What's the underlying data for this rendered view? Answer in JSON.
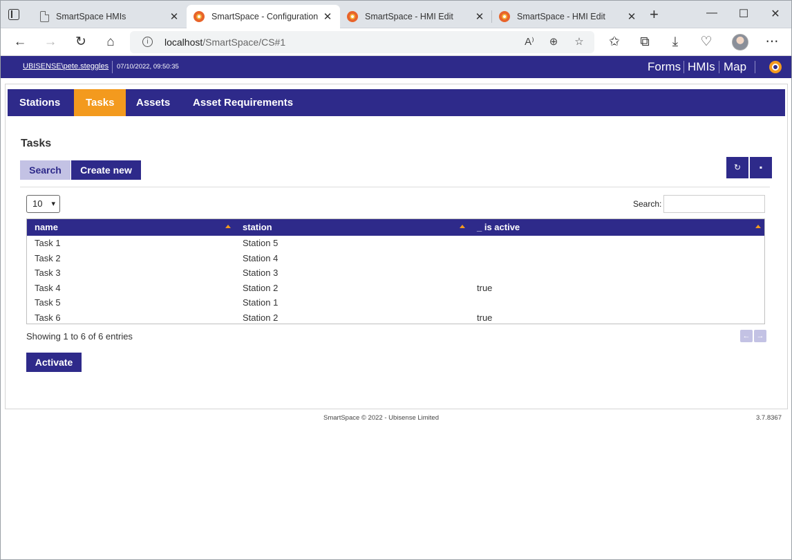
{
  "browser": {
    "tabs": [
      {
        "label": "SmartSpace HMIs",
        "active": false
      },
      {
        "label": "SmartSpace - Configuration",
        "active": true
      },
      {
        "label": "SmartSpace - HMI Edit",
        "active": false
      },
      {
        "label": "SmartSpace - HMI Edit",
        "active": false
      }
    ],
    "close_glyph": "✕",
    "new_tab_glyph": "+",
    "window_controls": {
      "minimize": "—",
      "maximize": "☐",
      "close": "✕"
    },
    "nav": {
      "back": "←",
      "forward": "→",
      "reload": "↻",
      "home": "⌂"
    },
    "address": {
      "host": "localhost",
      "path": "/SmartSpace/CS#1"
    },
    "toolbar_icons": {
      "read_aloud": "A⁾",
      "zoom": "⊕",
      "favorite_add": "☆",
      "favorites": "✩",
      "collections": "⧉",
      "downloads": "⤓",
      "health": "♡",
      "more": "⋯"
    }
  },
  "app": {
    "user": "UBISENSE\\pete.steggles",
    "datetime": "07/10/2022, 09:50:35",
    "nav": [
      {
        "label": "Forms"
      },
      {
        "label": "HMIs"
      },
      {
        "label": "Map"
      }
    ],
    "brand_color": "#2e2a8a",
    "accent_color": "#f39a1e"
  },
  "tabs": [
    {
      "label": "Stations",
      "active": false
    },
    {
      "label": "Tasks",
      "active": true
    },
    {
      "label": "Assets",
      "active": false
    },
    {
      "label": "Asset Requirements",
      "active": false
    }
  ],
  "section": {
    "title": "Tasks",
    "search_button": "Search",
    "create_button": "Create new",
    "refresh_icon": "↻",
    "save_icon": "▪"
  },
  "table": {
    "page_length": "10",
    "search_label": "Search:",
    "search_value": "",
    "columns": [
      {
        "label": "name"
      },
      {
        "label": "station"
      },
      {
        "label": "_ is active"
      }
    ],
    "rows": [
      {
        "name": "Task 1",
        "station": "Station 5",
        "is_active": ""
      },
      {
        "name": "Task 2",
        "station": "Station 4",
        "is_active": ""
      },
      {
        "name": "Task 3",
        "station": "Station 3",
        "is_active": ""
      },
      {
        "name": "Task 4",
        "station": "Station 2",
        "is_active": "true"
      },
      {
        "name": "Task 5",
        "station": "Station 1",
        "is_active": ""
      },
      {
        "name": "Task 6",
        "station": "Station 2",
        "is_active": "true"
      }
    ],
    "info": "Showing 1 to 6 of 6 entries",
    "prev_glyph": "←",
    "next_glyph": "→"
  },
  "actions": {
    "activate": "Activate"
  },
  "footer": {
    "copyright": "SmartSpace © 2022 - Ubisense Limited",
    "version": "3.7.8367"
  }
}
